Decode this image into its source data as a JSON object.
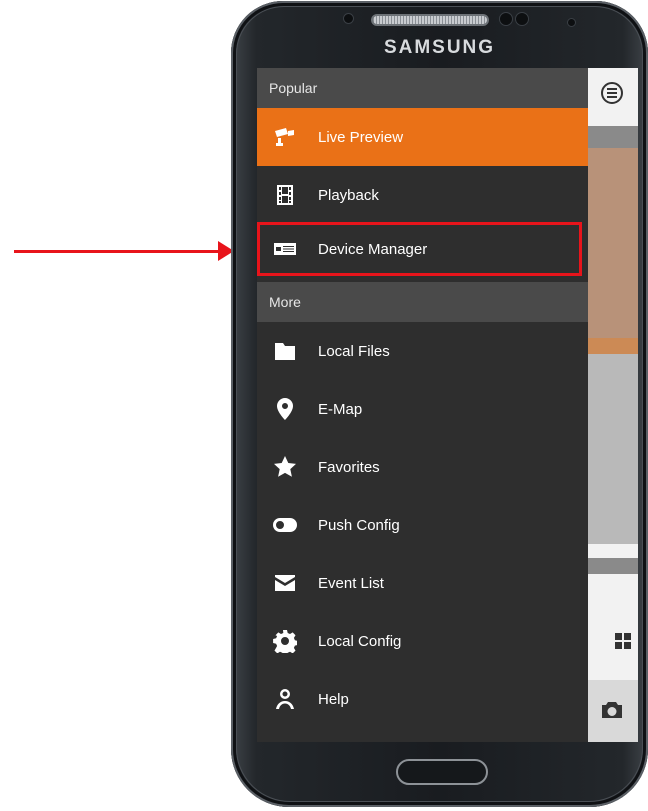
{
  "phone": {
    "brand": "SAMSUNG"
  },
  "menu": {
    "popular_header": "Popular",
    "popular_items": [
      {
        "label": "Live Preview",
        "icon": "cctv-camera-icon",
        "active": true
      },
      {
        "label": "Playback",
        "icon": "film-strip-icon"
      },
      {
        "label": "Device Manager",
        "icon": "device-dvr-icon",
        "highlighted": true
      }
    ],
    "more_header": "More",
    "more_items": [
      {
        "label": "Local Files",
        "icon": "folder-icon"
      },
      {
        "label": "E-Map",
        "icon": "map-pin-icon"
      },
      {
        "label": "Favorites",
        "icon": "star-icon"
      },
      {
        "label": "Push Config",
        "icon": "toggle-icon"
      },
      {
        "label": "Event List",
        "icon": "envelope-icon"
      },
      {
        "label": "Local Config",
        "icon": "gear-icon"
      },
      {
        "label": "Help",
        "icon": "person-icon"
      }
    ]
  },
  "colors": {
    "active": "#ea7117",
    "annotation": "#e8141b",
    "drawer": "#2e2e2e",
    "header": "#4a4a4a"
  }
}
